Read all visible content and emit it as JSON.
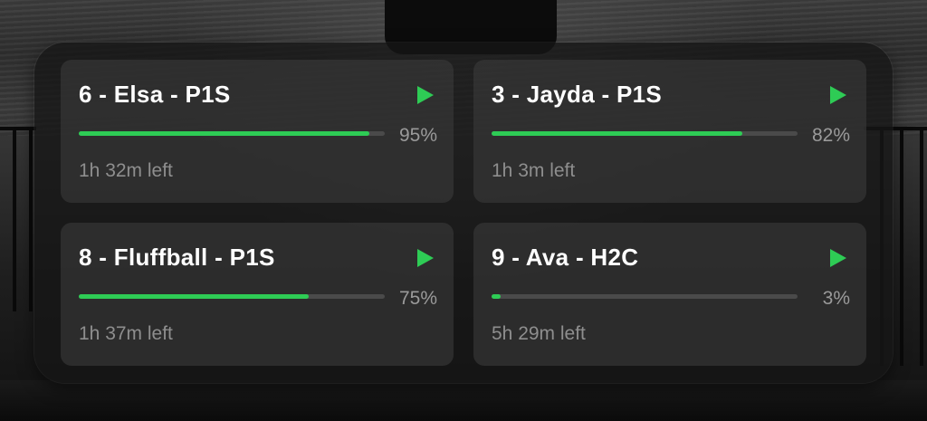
{
  "colors": {
    "accent": "#2ecc55",
    "card_bg": "#3a3a3a",
    "text_primary": "#ffffff",
    "text_secondary": "#8e8e8e"
  },
  "printers": [
    {
      "title": "6 - Elsa - P1S",
      "percent_label": "95%",
      "progress": 0.95,
      "remaining": "1h 32m left",
      "action_icon": "play-icon"
    },
    {
      "title": "3 - Jayda - P1S",
      "percent_label": "82%",
      "progress": 0.82,
      "remaining": "1h 3m left",
      "action_icon": "play-icon"
    },
    {
      "title": "8 - Fluffball - P1S",
      "percent_label": "75%",
      "progress": 0.75,
      "remaining": "1h 37m left",
      "action_icon": "play-icon"
    },
    {
      "title": "9 - Ava - H2C",
      "percent_label": "3%",
      "progress": 0.03,
      "remaining": "5h 29m left",
      "action_icon": "play-icon"
    }
  ]
}
